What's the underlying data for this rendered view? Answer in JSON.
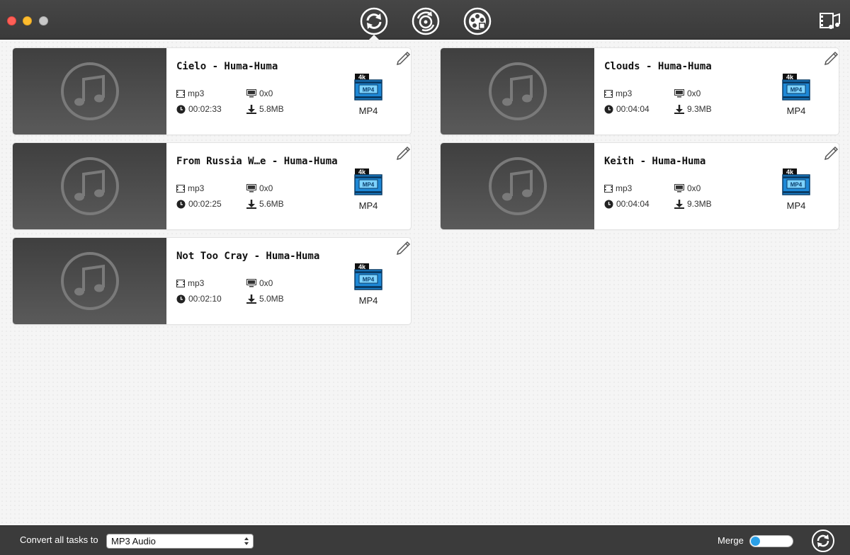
{
  "toolbar": {
    "buttons": [
      {
        "name": "convert-tab",
        "icon": "convert-icon",
        "active": true
      },
      {
        "name": "burn-tab",
        "icon": "burn-disc-icon",
        "active": false
      },
      {
        "name": "toolbox-tab",
        "icon": "film-reel-icon",
        "active": false
      }
    ],
    "right_icon": "media-library-icon"
  },
  "tasks": [
    {
      "title": "Cielo - Huma-Huma",
      "codec": "mp3",
      "resolution": "0x0",
      "duration": "00:02:33",
      "size": "5.8MB",
      "format": "MP4",
      "badge_top": "4k",
      "badge_text": "MP4"
    },
    {
      "title": "Clouds - Huma-Huma",
      "codec": "mp3",
      "resolution": "0x0",
      "duration": "00:04:04",
      "size": "9.3MB",
      "format": "MP4",
      "badge_top": "4k",
      "badge_text": "MP4"
    },
    {
      "title": "From Russia W…e - Huma-Huma",
      "codec": "mp3",
      "resolution": "0x0",
      "duration": "00:02:25",
      "size": "5.6MB",
      "format": "MP4",
      "badge_top": "4k",
      "badge_text": "MP4"
    },
    {
      "title": "Keith - Huma-Huma",
      "codec": "mp3",
      "resolution": "0x0",
      "duration": "00:04:04",
      "size": "9.3MB",
      "format": "MP4",
      "badge_top": "4k",
      "badge_text": "MP4"
    },
    {
      "title": "Not Too Cray - Huma-Huma",
      "codec": "mp3",
      "resolution": "0x0",
      "duration": "00:02:10",
      "size": "5.0MB",
      "format": "MP4",
      "badge_top": "4k",
      "badge_text": "MP4"
    }
  ],
  "bottom": {
    "convert_label": "Convert all tasks to",
    "selected_format": "MP3 Audio",
    "merge_label": "Merge",
    "merge_on": false
  },
  "colors": {
    "titlebar": "#3f3f3f",
    "accent": "#2aa0e8",
    "thumb": "#4a4a4a"
  }
}
